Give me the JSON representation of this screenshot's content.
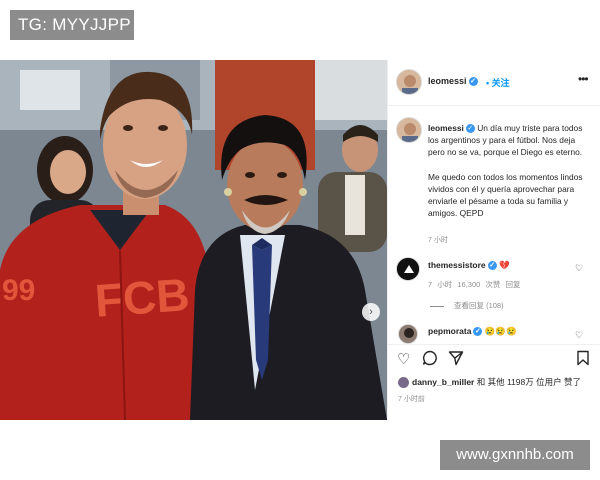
{
  "watermarks": {
    "top_left": "TG: MYYJJPP",
    "bottom_right": "www.gxnnhb.com"
  },
  "post": {
    "author": "leomessi",
    "follow_label": "关注",
    "more_icon": "more-icon",
    "caption": "Un día muy triste para todos los argentinos y para el fútbol. Nos deja pero no se va, porque el Diego es eterno.\n\nMe quedo con todos los momentos lindos vividos con él y quería aprovechar para enviarle el pésame a toda su familia y amigos. QEPD",
    "caption_time": "7 小时",
    "comments": [
      {
        "username": "themessistore",
        "text": "💔",
        "time": "7 小时",
        "likes": "16,300 次赞",
        "reply": "回复",
        "view_replies": "查看回复 (108)"
      },
      {
        "username": "pepmorata",
        "text": "😢😢😢"
      }
    ],
    "likes_text_user": "danny_b_miller",
    "likes_text_rest": " 和 其他 1198万 位用户 赞了",
    "post_time": "7 小时前",
    "colors": {
      "verified": "#3897f0",
      "follow": "#0095f6",
      "secondary_text": "#8e8e8e"
    }
  }
}
